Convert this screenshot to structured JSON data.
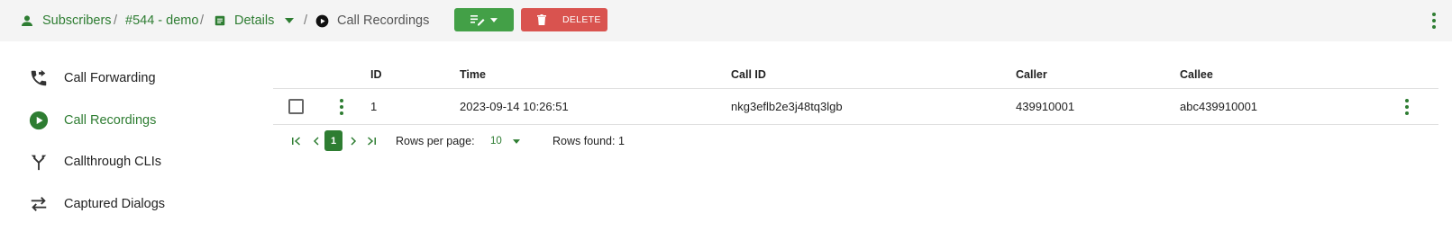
{
  "breadcrumb": {
    "subscribers": "Subscribers",
    "subscriber": "#544 - demo",
    "details": "Details",
    "current": "Call Recordings",
    "separator": "/"
  },
  "toolbar": {
    "delete_label": "DELETE"
  },
  "sidebar": {
    "items": [
      {
        "label": "Call Forwarding",
        "icon": "call-forward-icon",
        "active": false
      },
      {
        "label": "Call Recordings",
        "icon": "play-circle-icon",
        "active": true
      },
      {
        "label": "Callthrough CLIs",
        "icon": "call-split-icon",
        "active": false
      },
      {
        "label": "Captured Dialogs",
        "icon": "swap-arrows-icon",
        "active": false
      }
    ]
  },
  "table": {
    "columns": [
      "ID",
      "Time",
      "Call ID",
      "Caller",
      "Callee"
    ],
    "rows": [
      {
        "id": "1",
        "time": "2023-09-14 10:26:51",
        "call_id": "nkg3eflb2e3j48tq3lgb",
        "caller": "439910001",
        "callee": "abc439910001"
      }
    ]
  },
  "pagination": {
    "current_page": "1",
    "rows_per_page_label": "Rows per page:",
    "rows_per_page_value": "10",
    "rows_found": "Rows found: 1"
  },
  "colors": {
    "primary": "#2e7d32",
    "edit_button": "#43a047",
    "delete_button": "#d9534f",
    "topbar_bg": "#f4f4f4"
  }
}
